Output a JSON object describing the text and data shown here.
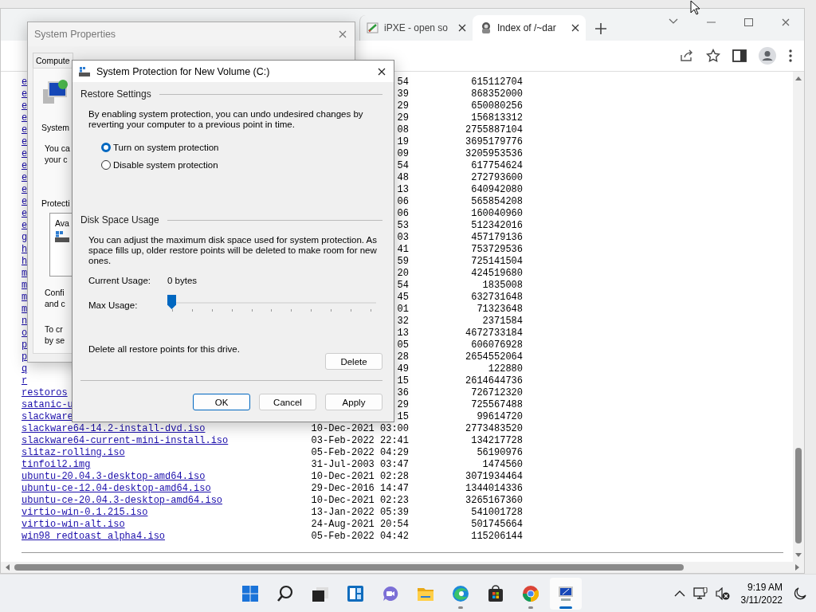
{
  "browser": {
    "tabs": [
      {
        "title": "iPXE - open so",
        "selected": false
      },
      {
        "title": "Index of /~dar",
        "selected": true
      }
    ],
    "listing": {
      "rows": [
        {
          "name": "e",
          "date": "54",
          "size": "615112704"
        },
        {
          "name": "e",
          "date": "39",
          "size": "868352000"
        },
        {
          "name": "e",
          "date": "29",
          "size": "650080256"
        },
        {
          "name": "e",
          "date": "29",
          "size": "156813312"
        },
        {
          "name": "e",
          "date": "08",
          "size": "2755887104"
        },
        {
          "name": "e",
          "date": "19",
          "size": "3695179776"
        },
        {
          "name": "e",
          "date": "09",
          "size": "3205953536"
        },
        {
          "name": "e",
          "date": "54",
          "size": "617754624"
        },
        {
          "name": "e",
          "date": "48",
          "size": "272793600"
        },
        {
          "name": "e",
          "date": "13",
          "size": "640942080"
        },
        {
          "name": "e",
          "date": "06",
          "size": "565854208"
        },
        {
          "name": "e",
          "date": "06",
          "size": "160040960"
        },
        {
          "name": "e",
          "date": "53",
          "size": "512342016"
        },
        {
          "name": "g",
          "date": "03",
          "size": "457179136"
        },
        {
          "name": "h",
          "date": "41",
          "size": "753729536"
        },
        {
          "name": "h",
          "date": "59",
          "size": "725141504"
        },
        {
          "name": "m",
          "date": "20",
          "size": "424519680"
        },
        {
          "name": "m",
          "date": "54",
          "size": "1835008"
        },
        {
          "name": "m",
          "date": "45",
          "size": "632731648"
        },
        {
          "name": "m",
          "date": "01",
          "size": "71323648"
        },
        {
          "name": "n",
          "date": "32",
          "size": "2371584"
        },
        {
          "name": "o",
          "date": "13",
          "size": "4672733184"
        },
        {
          "name": "p",
          "date": "05",
          "size": "606076928"
        },
        {
          "name": "p",
          "date": "28",
          "size": "2654552064"
        },
        {
          "name": "q",
          "date": "49",
          "size": "122880"
        },
        {
          "name": "r",
          "date": "15",
          "size": "2614644736"
        },
        {
          "name": "restoros",
          "date": "36",
          "size": "726712320"
        },
        {
          "name": "satanic-u",
          "date": "29",
          "size": "725567488"
        },
        {
          "name": "slackware",
          "date": "15",
          "size": "99614720"
        },
        {
          "name": "slackware64-14.2-install-dvd.iso",
          "date": "10-Dec-2021 03:00",
          "size": "2773483520"
        },
        {
          "name": "slackware64-current-mini-install.iso",
          "date": "03-Feb-2022 22:41",
          "size": "134217728"
        },
        {
          "name": "slitaz-rolling.iso",
          "date": "05-Feb-2022 04:29",
          "size": "56190976"
        },
        {
          "name": "tinfoil2.img",
          "date": "31-Jul-2003 03:47",
          "size": "1474560"
        },
        {
          "name": "ubuntu-20.04.3-desktop-amd64.iso",
          "date": "10-Dec-2021 02:28",
          "size": "3071934464"
        },
        {
          "name": "ubuntu-ce-12.04-desktop-amd64.iso",
          "date": "29-Dec-2016 14:47",
          "size": "1344014336"
        },
        {
          "name": "ubuntu-ce-20.04.3-desktop-amd64.iso",
          "date": "10-Dec-2021 02:23",
          "size": "3265167360"
        },
        {
          "name": "virtio-win-0.1.215.iso",
          "date": "13-Jan-2022 05:39",
          "size": "541001728"
        },
        {
          "name": "virtio-win-alt.iso",
          "date": "24-Aug-2021 20:54",
          "size": "501745664"
        },
        {
          "name": "win98_redtoast_alpha4.iso",
          "date": "05-Feb-2022 04:42",
          "size": "115206144"
        }
      ]
    }
  },
  "system_properties": {
    "title": "System Properties",
    "tabs": [
      {
        "label": "Compute",
        "selected": false
      }
    ],
    "heading": "System",
    "intro_lines": [
      "You ca",
      "your c"
    ],
    "protection_label": "Protecti",
    "list_header": "Ava",
    "config_lines": [
      "Confi",
      "and c"
    ],
    "create_lines": [
      "To cr",
      "by se"
    ]
  },
  "dialog": {
    "title": "System Protection for New Volume (C:)",
    "restore_settings": {
      "heading": "Restore Settings",
      "description": "By enabling system protection, you can undo undesired changes by reverting your computer to a previous point in time.",
      "options": [
        {
          "label": "Turn on system protection",
          "selected": true
        },
        {
          "label": "Disable system protection",
          "selected": false
        }
      ]
    },
    "disk_space": {
      "heading": "Disk Space Usage",
      "description": "You can adjust the maximum disk space used for system protection. As space fills up, older restore points will be deleted to make room for new ones.",
      "current_usage_label": "Current Usage:",
      "current_usage": "0 bytes",
      "max_usage_label": "Max Usage:",
      "max_usage": {
        "level": 0
      },
      "delete_text": "Delete all restore points for this drive.",
      "delete_button": "Delete"
    },
    "buttons": [
      {
        "label": "OK",
        "default": true
      },
      {
        "label": "Cancel",
        "default": false
      },
      {
        "label": "Apply",
        "default": false
      }
    ]
  },
  "taskbar": {
    "apps": [
      {
        "kind": "start",
        "running": false,
        "active": false
      },
      {
        "kind": "search",
        "running": false,
        "active": false
      },
      {
        "kind": "taskview",
        "running": false,
        "active": false
      },
      {
        "kind": "widgets",
        "running": false,
        "active": false
      },
      {
        "kind": "chat",
        "running": false,
        "active": false
      },
      {
        "kind": "explorer",
        "running": false,
        "active": false
      },
      {
        "kind": "edge",
        "running": true,
        "active": false
      },
      {
        "kind": "store",
        "running": false,
        "active": false
      },
      {
        "kind": "chrome",
        "running": true,
        "active": false
      },
      {
        "kind": "sysprop",
        "running": true,
        "active": true
      }
    ],
    "time": "9:19 AM",
    "date": "3/11/2022"
  }
}
